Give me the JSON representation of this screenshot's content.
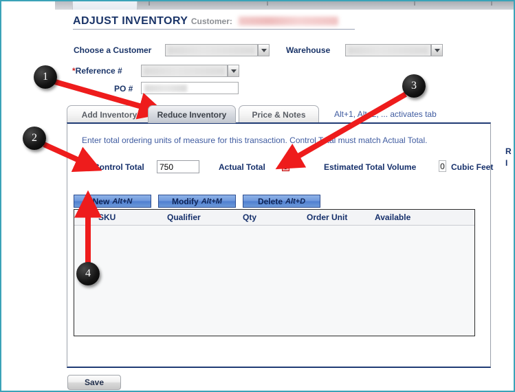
{
  "window": {
    "title": "ADJUST INVENTORY",
    "customer_label": "Customer:",
    "customer_value_redacted": true
  },
  "form": {
    "choose_customer_label": "Choose a Customer",
    "choose_customer_value": "",
    "warehouse_label": "Warehouse",
    "warehouse_value": "",
    "reference_required_marker": "*",
    "reference_label": "Reference #",
    "reference_value": "",
    "po_label": "PO #",
    "po_value": ""
  },
  "tabs": {
    "items": [
      {
        "label": "Add Inventory",
        "active": false
      },
      {
        "label": "Reduce Inventory",
        "active": true
      },
      {
        "label": "Price & Notes",
        "active": false
      }
    ],
    "hint": "Alt+1, Alt+2, ... activates tab"
  },
  "panel": {
    "instruction": "Enter total ordering units of measure for this transaction. Control Total must match Actual Total.",
    "control_total_label": "Control Total",
    "control_total_value": "750",
    "actual_total_label": "Actual Total",
    "actual_total_value": "0",
    "actual_total_state": "error",
    "estimated_volume_label": "Estimated Total Volume",
    "estimated_volume_value": "0",
    "volume_units": "Cubic Feet",
    "clipped_right_line1": "R",
    "clipped_right_line2": "I"
  },
  "actions": {
    "new_label": "New",
    "new_accel": "Alt+N",
    "modify_label": "Modify",
    "modify_accel": "Alt+M",
    "delete_label": "Delete",
    "delete_accel": "Alt+D"
  },
  "grid": {
    "columns": [
      "SKU",
      "Qualifier",
      "Qty",
      "Order Unit",
      "Available"
    ],
    "rows": []
  },
  "footer": {
    "save_label": "Save"
  },
  "annotations": {
    "markers": [
      {
        "number": "1",
        "target": "reduce-inventory-tab"
      },
      {
        "number": "2",
        "target": "control-total-label"
      },
      {
        "number": "3",
        "target": "actual-total-value"
      },
      {
        "number": "4",
        "target": "new-button"
      }
    ],
    "color": "#ee1c1c"
  },
  "colors": {
    "accent_navy": "#16306b",
    "hint_blue": "#3f5ba0",
    "error_red": "#c01111",
    "annotation_red": "#ee1c1c",
    "border_teal": "#3aa3b8"
  }
}
